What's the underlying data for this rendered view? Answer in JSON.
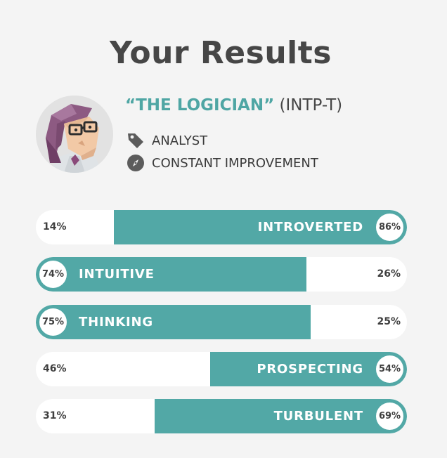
{
  "header": {
    "title": "Your Results"
  },
  "profile": {
    "avatar_icon": "logician-avatar",
    "type_name": "“THE LOGICIAN”",
    "type_code": "(INTP-T)",
    "traits": [
      {
        "icon": "tag-icon",
        "label": "ANALYST"
      },
      {
        "icon": "compass-icon",
        "label": "CONSTANT IMPROVEMENT"
      }
    ]
  },
  "colors": {
    "accent": "#52a8a6",
    "track": "#ffffff",
    "title": "#464646",
    "type_name": "#4fa6a4"
  },
  "scales": [
    {
      "label": "INTROVERTED",
      "dominant_pct": "86%",
      "other_pct": "14%",
      "dominant_side": "right",
      "fill_fraction": 0.79
    },
    {
      "label": "INTUITIVE",
      "dominant_pct": "74%",
      "other_pct": "26%",
      "dominant_side": "left",
      "fill_fraction": 0.73
    },
    {
      "label": "THINKING",
      "dominant_pct": "75%",
      "other_pct": "25%",
      "dominant_side": "left",
      "fill_fraction": 0.74
    },
    {
      "label": "PROSPECTING",
      "dominant_pct": "54%",
      "other_pct": "46%",
      "dominant_side": "right",
      "fill_fraction": 0.53
    },
    {
      "label": "TURBULENT",
      "dominant_pct": "69%",
      "other_pct": "31%",
      "dominant_side": "right",
      "fill_fraction": 0.68
    }
  ]
}
